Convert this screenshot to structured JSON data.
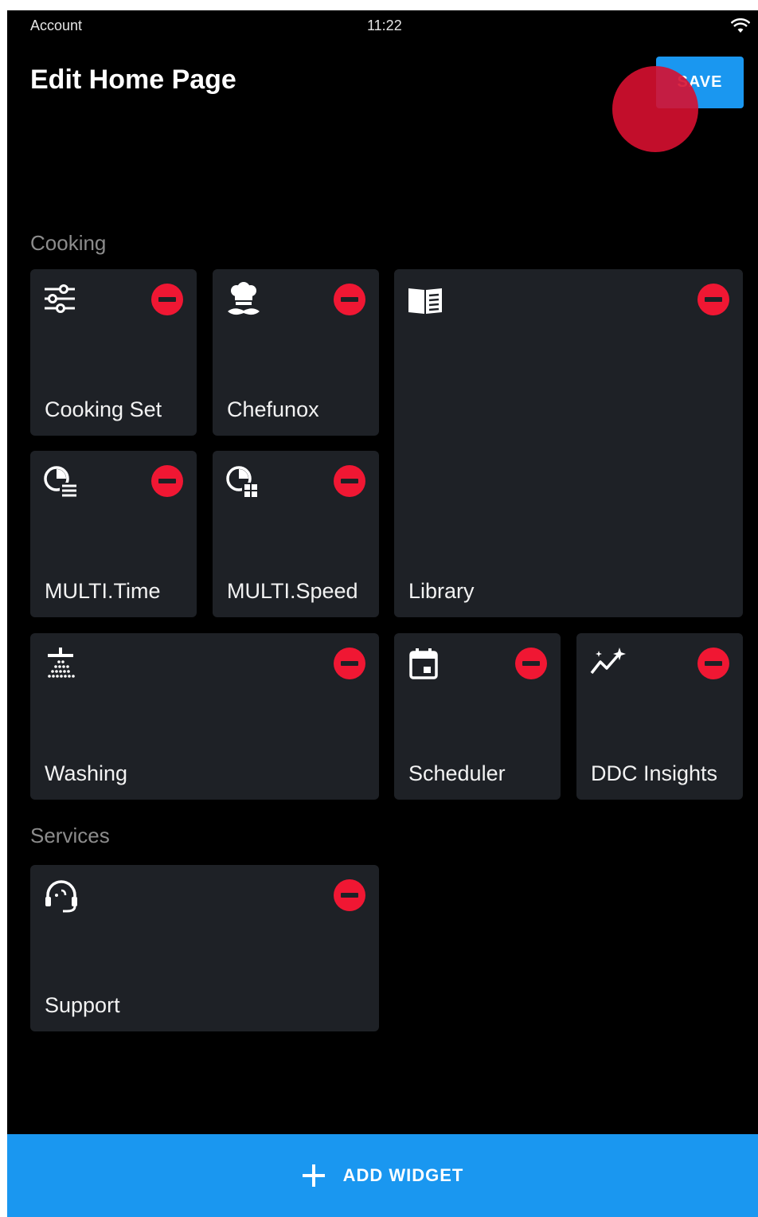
{
  "status_bar": {
    "account": "Account",
    "time": "11:22"
  },
  "header": {
    "title": "Edit Home Page",
    "save_label": "SAVE"
  },
  "sections": {
    "cooking": "Cooking",
    "services": "Services"
  },
  "tiles": {
    "cooking_set": {
      "label": "Cooking Set",
      "icon": "sliders-icon"
    },
    "chefunox": {
      "label": "Chefunox",
      "icon": "chef-icon"
    },
    "library": {
      "label": "Library",
      "icon": "book-icon"
    },
    "multi_time": {
      "label": "MULTI.Time",
      "icon": "timer-list-icon"
    },
    "multi_speed": {
      "label": "MULTI.Speed",
      "icon": "timer-grid-icon"
    },
    "washing": {
      "label": "Washing",
      "icon": "shower-icon"
    },
    "scheduler": {
      "label": "Scheduler",
      "icon": "calendar-icon"
    },
    "ddc_insights": {
      "label": "DDC Insights",
      "icon": "trend-icon"
    },
    "support": {
      "label": "Support",
      "icon": "headset-icon"
    }
  },
  "footer": {
    "add_widget_label": "ADD WIDGET"
  },
  "colors": {
    "accent": "#1a97f0",
    "remove": "#f01733",
    "tile": "#1e2126",
    "background": "#000000",
    "touch": "#d71030"
  }
}
